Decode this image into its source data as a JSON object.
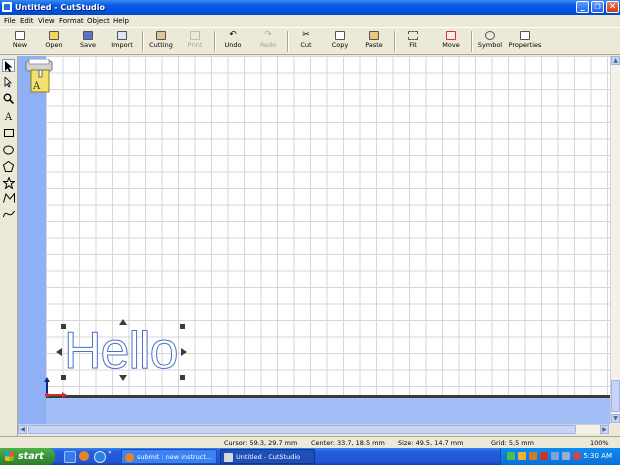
{
  "window": {
    "title": "Untitled - CutStudio",
    "minimize": "_",
    "restore": "❐",
    "close": "✕"
  },
  "menu": [
    "File",
    "Edit",
    "View",
    "Format",
    "Object",
    "Help"
  ],
  "toolbar": [
    {
      "label": "New",
      "enabled": true,
      "icon": "new-file-icon"
    },
    {
      "label": "Open",
      "enabled": true,
      "icon": "open-folder-icon"
    },
    {
      "label": "Save",
      "enabled": true,
      "icon": "save-icon"
    },
    {
      "label": "Import",
      "enabled": true,
      "icon": "import-icon"
    },
    {
      "label": "Cutting",
      "enabled": true,
      "icon": "cutting-icon"
    },
    {
      "label": "Print",
      "enabled": false,
      "icon": "print-icon"
    },
    {
      "label": "Undo",
      "enabled": true,
      "icon": "undo-icon"
    },
    {
      "label": "Redo",
      "enabled": false,
      "icon": "redo-icon"
    },
    {
      "label": "Cut",
      "enabled": true,
      "icon": "scissors-icon"
    },
    {
      "label": "Copy",
      "enabled": true,
      "icon": "copy-icon"
    },
    {
      "label": "Paste",
      "enabled": true,
      "icon": "paste-icon"
    },
    {
      "label": "Fit",
      "enabled": true,
      "icon": "fit-icon"
    },
    {
      "label": "Move",
      "enabled": true,
      "icon": "move-icon"
    },
    {
      "label": "Symbol",
      "enabled": true,
      "icon": "symbol-icon"
    },
    {
      "label": "Properties",
      "enabled": true,
      "icon": "properties-icon"
    }
  ],
  "tools": [
    "select-arrow-icon",
    "node-edit-icon",
    "zoom-icon",
    "text-tool-icon",
    "rectangle-tool-icon",
    "ellipse-tool-icon",
    "polygon-tool-icon",
    "star-tool-icon",
    "polyline-tool-icon",
    "curve-tool-icon"
  ],
  "tool_text_glyph": "A",
  "canvas": {
    "object_text": "Hello"
  },
  "status": {
    "cursor": "Cursor: 59.3, 29.7 mm",
    "center": "Center: 33.7, 18.5 mm",
    "size": "Size: 49.5, 14.7 mm",
    "grid": "Grid: 5,5 mm",
    "zoom": "100%"
  },
  "taskbar": {
    "start": "start",
    "tasks": [
      {
        "label": "submit : new instruct...",
        "active": false
      },
      {
        "label": "Untitled - CutStudio",
        "active": true
      }
    ],
    "clock": "5:30 AM"
  },
  "colors": {
    "titlebar": "#0054e3",
    "paper_margin": "#8fb0f5",
    "taskbar": "#245edb",
    "start": "#3a8f37",
    "text_outline": "#4b72c8"
  }
}
